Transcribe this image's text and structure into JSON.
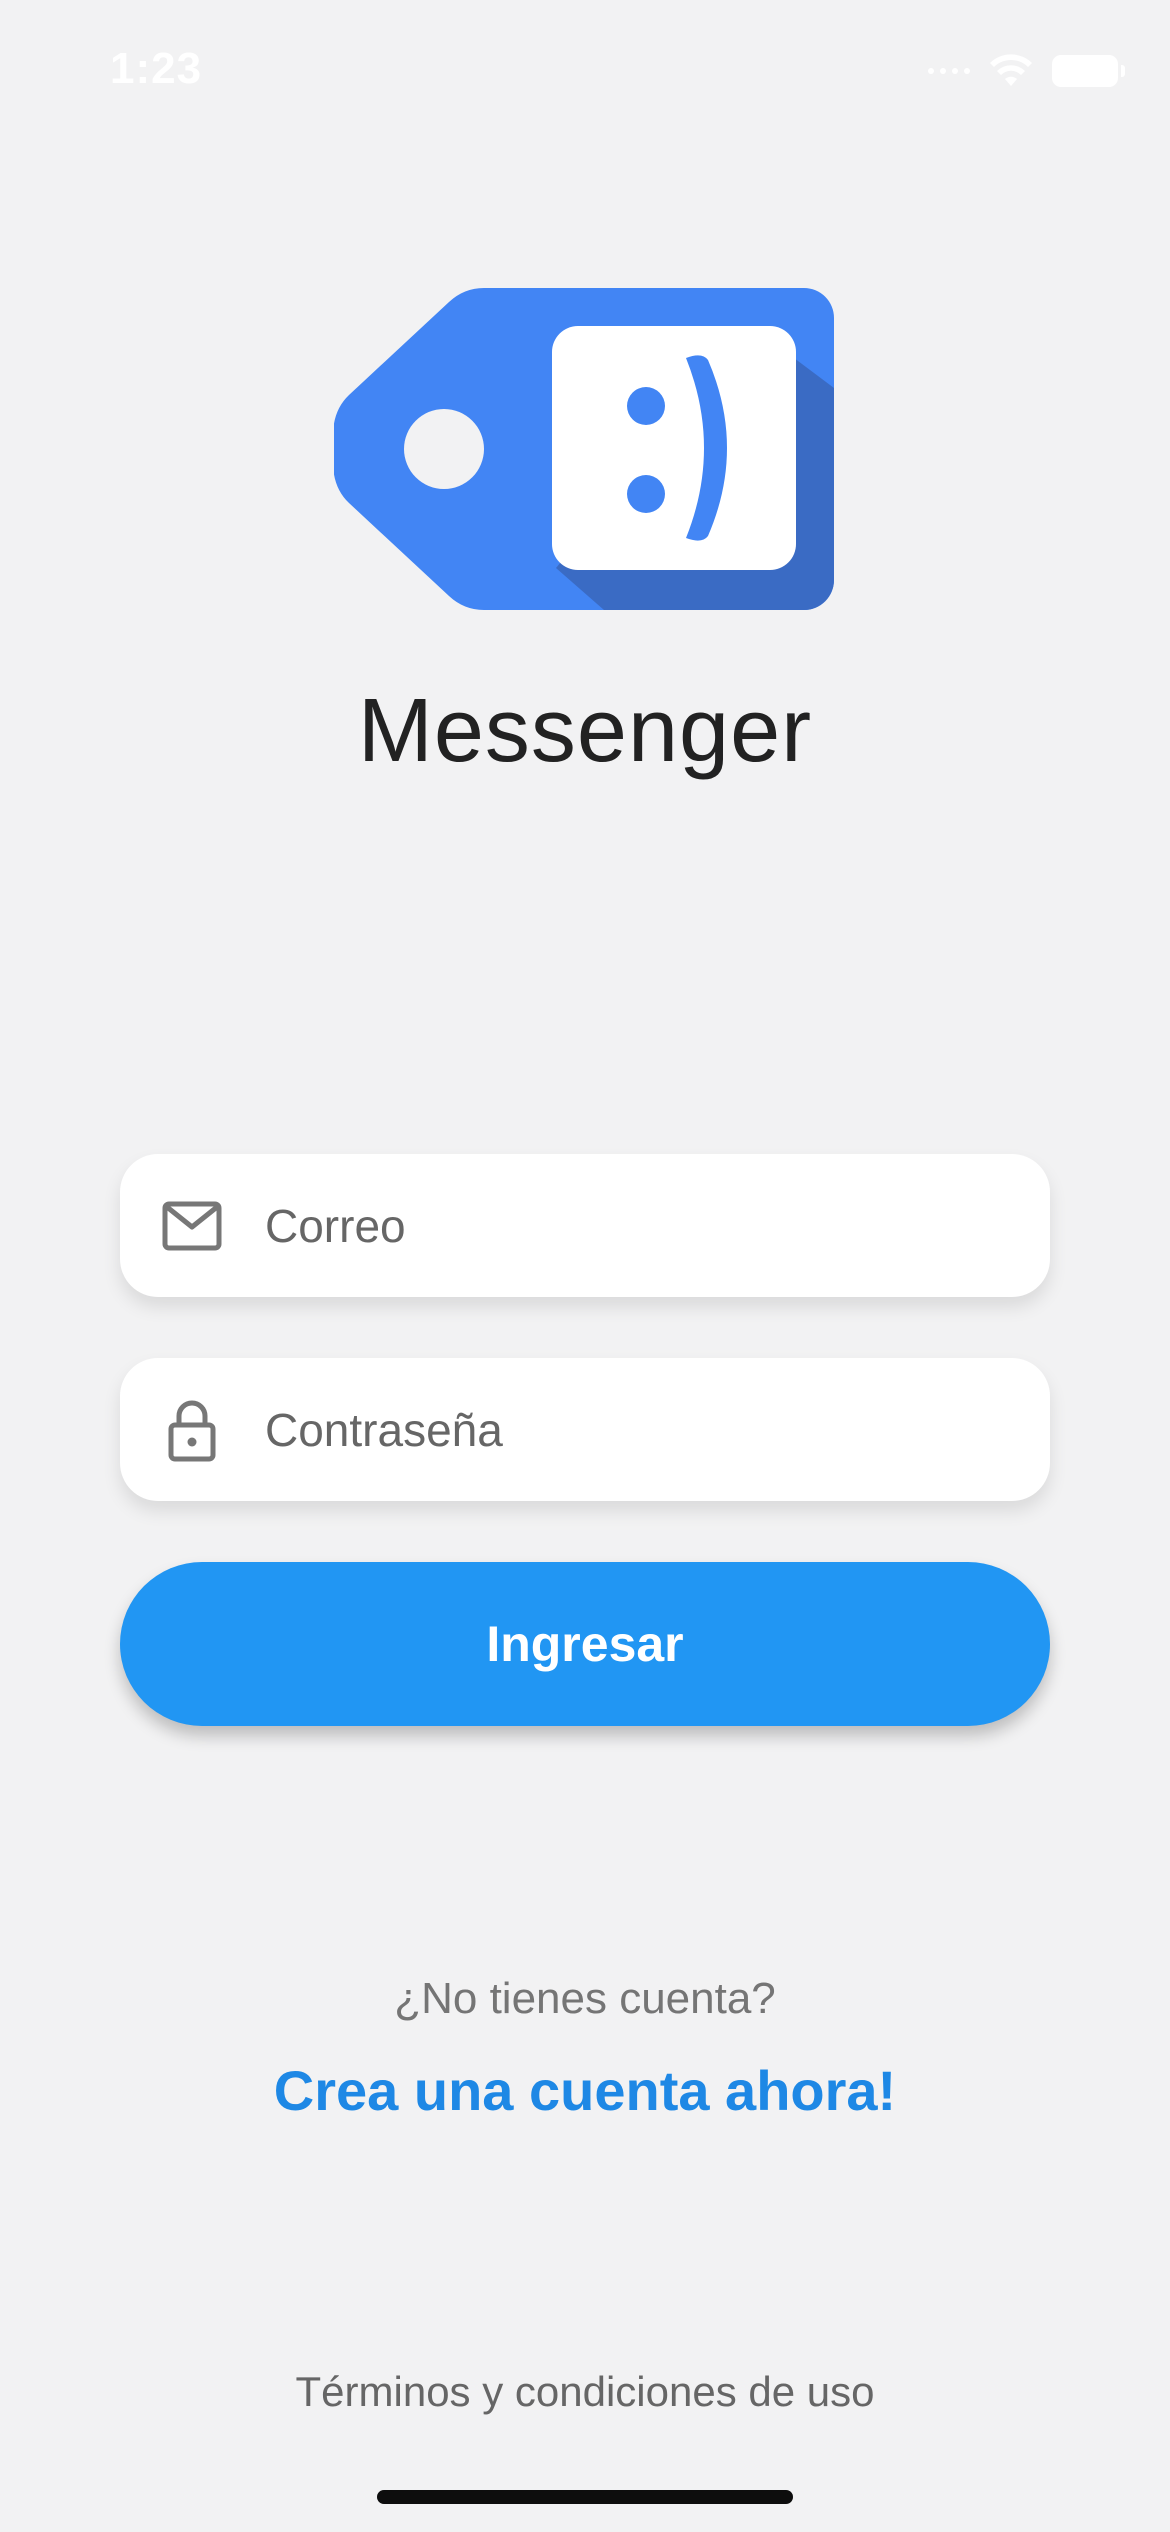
{
  "status_bar": {
    "time": "1:23",
    "icons": [
      "signal-icon",
      "wifi-icon",
      "battery-icon"
    ]
  },
  "app": {
    "title": "Messenger",
    "logo_icon": "messenger-tag-smiley-logo",
    "brand_color": "#4285f4"
  },
  "form": {
    "email": {
      "icon": "mail-icon",
      "placeholder": "Correo",
      "value": ""
    },
    "password": {
      "icon": "lock-icon",
      "placeholder": "Contraseña",
      "value": ""
    },
    "submit_label": "Ingresar",
    "submit_color": "#2196f3"
  },
  "signup": {
    "prompt": "¿No tienes cuenta?",
    "link_label": "Crea una cuenta ahora!",
    "link_color": "#1e88e5"
  },
  "footer": {
    "terms_label": "Términos y condiciones de uso"
  }
}
